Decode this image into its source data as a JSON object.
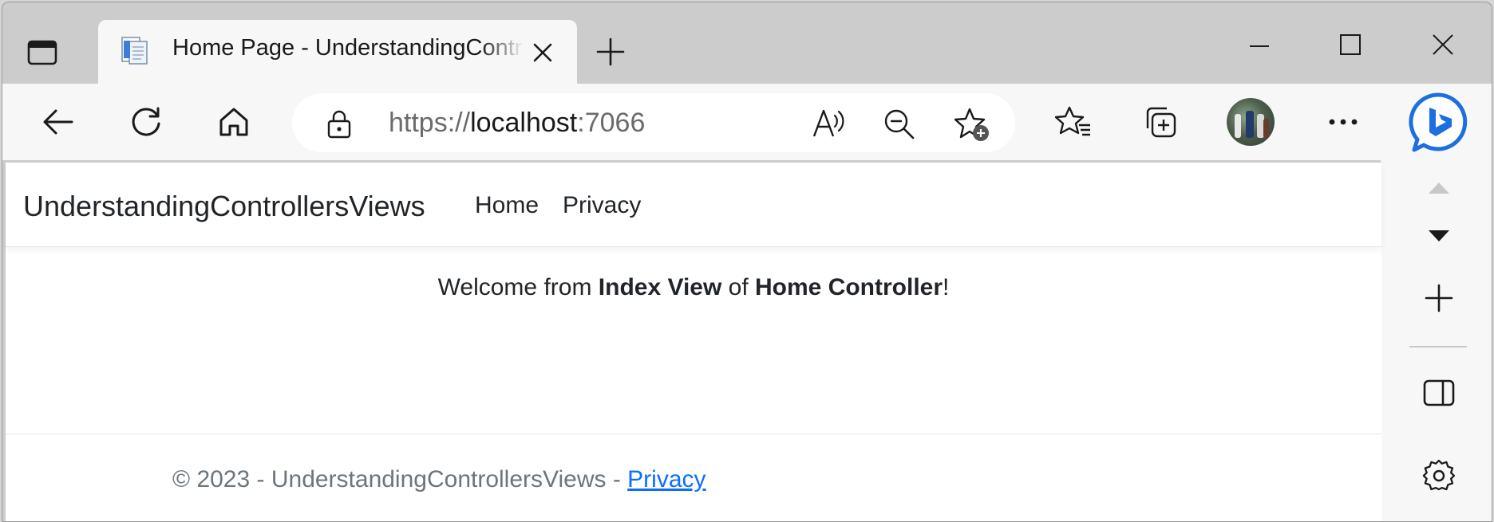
{
  "browser": {
    "tab": {
      "title": "Home Page - UnderstandingControllersViews",
      "favicon": "document-icon"
    },
    "address_bar": {
      "scheme": "https://",
      "host": "localhost",
      "port": ":7066"
    },
    "toolbar_icons": [
      "back-icon",
      "refresh-icon",
      "home-icon",
      "lock-icon",
      "read-aloud-icon",
      "zoom-out-icon",
      "add-favorite-icon",
      "favorites-icon",
      "collections-icon",
      "profile-avatar",
      "more-icon",
      "bing-chat-icon"
    ],
    "sidebar_icons": [
      "scroll-up-icon",
      "scroll-down-icon",
      "add-icon",
      "split-screen-icon",
      "settings-icon"
    ],
    "colors": {
      "chrome": "#cccccc",
      "toolbar": "#f7f7f7",
      "link": "#0d6efd",
      "bing_blue": "#1b6fe0"
    }
  },
  "page": {
    "navbar": {
      "brand": "UnderstandingControllersViews",
      "links": [
        "Home",
        "Privacy"
      ]
    },
    "welcome": {
      "prefix": "Welcome from ",
      "view": "Index View",
      "middle": " of ",
      "controller": "Home Controller",
      "suffix": "!"
    },
    "footer": {
      "text": "© 2023 - UnderstandingControllersViews - ",
      "link": "Privacy"
    }
  }
}
